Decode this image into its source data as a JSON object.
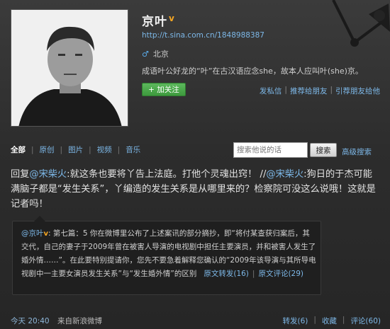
{
  "profile": {
    "username": "京叶",
    "verified_mark": "v",
    "url": "http://t.sina.com.cn/1848988387",
    "gender_icon": "male-icon",
    "location": "北京",
    "bio": "成语叶公好龙的“叶”在古汉语应念she，故本人应叫叶(she)京。",
    "follow_label": "+ 加关注",
    "actions": [
      "发私信",
      "推荐给朋友",
      "引荐朋友给他"
    ]
  },
  "tabs": [
    {
      "label": "全部",
      "active": true
    },
    {
      "label": "原创",
      "active": false
    },
    {
      "label": "图片",
      "active": false
    },
    {
      "label": "视频",
      "active": false
    },
    {
      "label": "音乐",
      "active": false
    }
  ],
  "search": {
    "placeholder": "搜索他说的话",
    "button_label": "搜索",
    "advanced_label": "高级搜索"
  },
  "post": {
    "prefix": "回复",
    "mention1": "@宋柴火",
    "text1": ":就这条也要将丫告上法庭。打他个灵魂出窍！ //",
    "mention2": "@宋柴火",
    "text2": ":狗日的于杰可能满脑子都是“发生关系”，丫编造的发生关系是从哪里来的？检察院可没这么说哦！这就是记者吗！"
  },
  "repost": {
    "author": "@京叶",
    "verified_mark": "v",
    "text": ": 第七篇：5 你在微博里公布了上述案讯的部分摘抄，即“将付某查获归案后，其交代，自己的妻子于2009年曾在被害人导演的电视剧中担任主要演员，并和被害人发生了婚外情……”。在此要特别提请你，您先不要急着解释您确认的“2009年该导演与其所导电视剧中一主要女演员发生关系”与“发生婚外情”的区别",
    "repost_link": "原文转发(16)",
    "comment_link": "原文评论(29)"
  },
  "footer": {
    "time": "今天 20:40",
    "source": "来自新浪微博",
    "repost": "转发(6)",
    "favorite": "收藏",
    "comment": "评论(60)"
  },
  "colors": {
    "link": "#7db8e8",
    "verified": "#f5a623",
    "follow_button": "#4caf50",
    "background": "#2d2d2d"
  }
}
